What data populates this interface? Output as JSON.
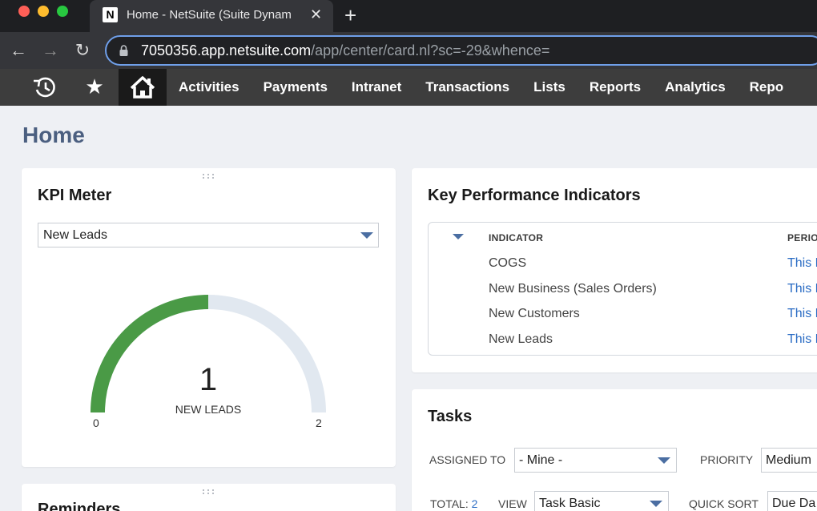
{
  "browser": {
    "tab_favicon": "N",
    "tab_title": "Home - NetSuite (Suite Dynam",
    "tab_close": "✕",
    "new_tab": "+",
    "back": "←",
    "forward": "→",
    "reload": "↻",
    "url_host": "7050356.app.netsuite.com",
    "url_path": "/app/center/card.nl?sc=-29&whence="
  },
  "ns_nav": {
    "star": "★",
    "items": [
      "Activities",
      "Payments",
      "Intranet",
      "Transactions",
      "Lists",
      "Reports",
      "Analytics",
      "Repo"
    ]
  },
  "page": {
    "title": "Home"
  },
  "kpi_meter": {
    "title": "KPI Meter",
    "selected": "New Leads",
    "value": "1",
    "label": "NEW LEADS",
    "min": "0",
    "max": "2",
    "fill_fraction": 0.5,
    "fill_color": "#4a9a46",
    "track_color": "#e1e8f0"
  },
  "kpi_table": {
    "title": "Key Performance Indicators",
    "col_indicator": "INDICATOR",
    "col_period": "PERIO",
    "rows": [
      {
        "indicator": "COGS",
        "period": "This P"
      },
      {
        "indicator": "New Business (Sales Orders)",
        "period": "This P"
      },
      {
        "indicator": "New Customers",
        "period": "This P"
      },
      {
        "indicator": "New Leads",
        "period": "This P"
      }
    ]
  },
  "tasks": {
    "title": "Tasks",
    "assigned_label": "ASSIGNED TO",
    "assigned_value": "- Mine -",
    "priority_label": "PRIORITY",
    "priority_value": "Medium",
    "total_label": "TOTAL:",
    "total_value": "2",
    "view_label": "VIEW",
    "view_value": "Task Basic",
    "sort_label": "QUICK SORT",
    "sort_value": "Due Da"
  },
  "reminders": {
    "title": "Reminders"
  }
}
